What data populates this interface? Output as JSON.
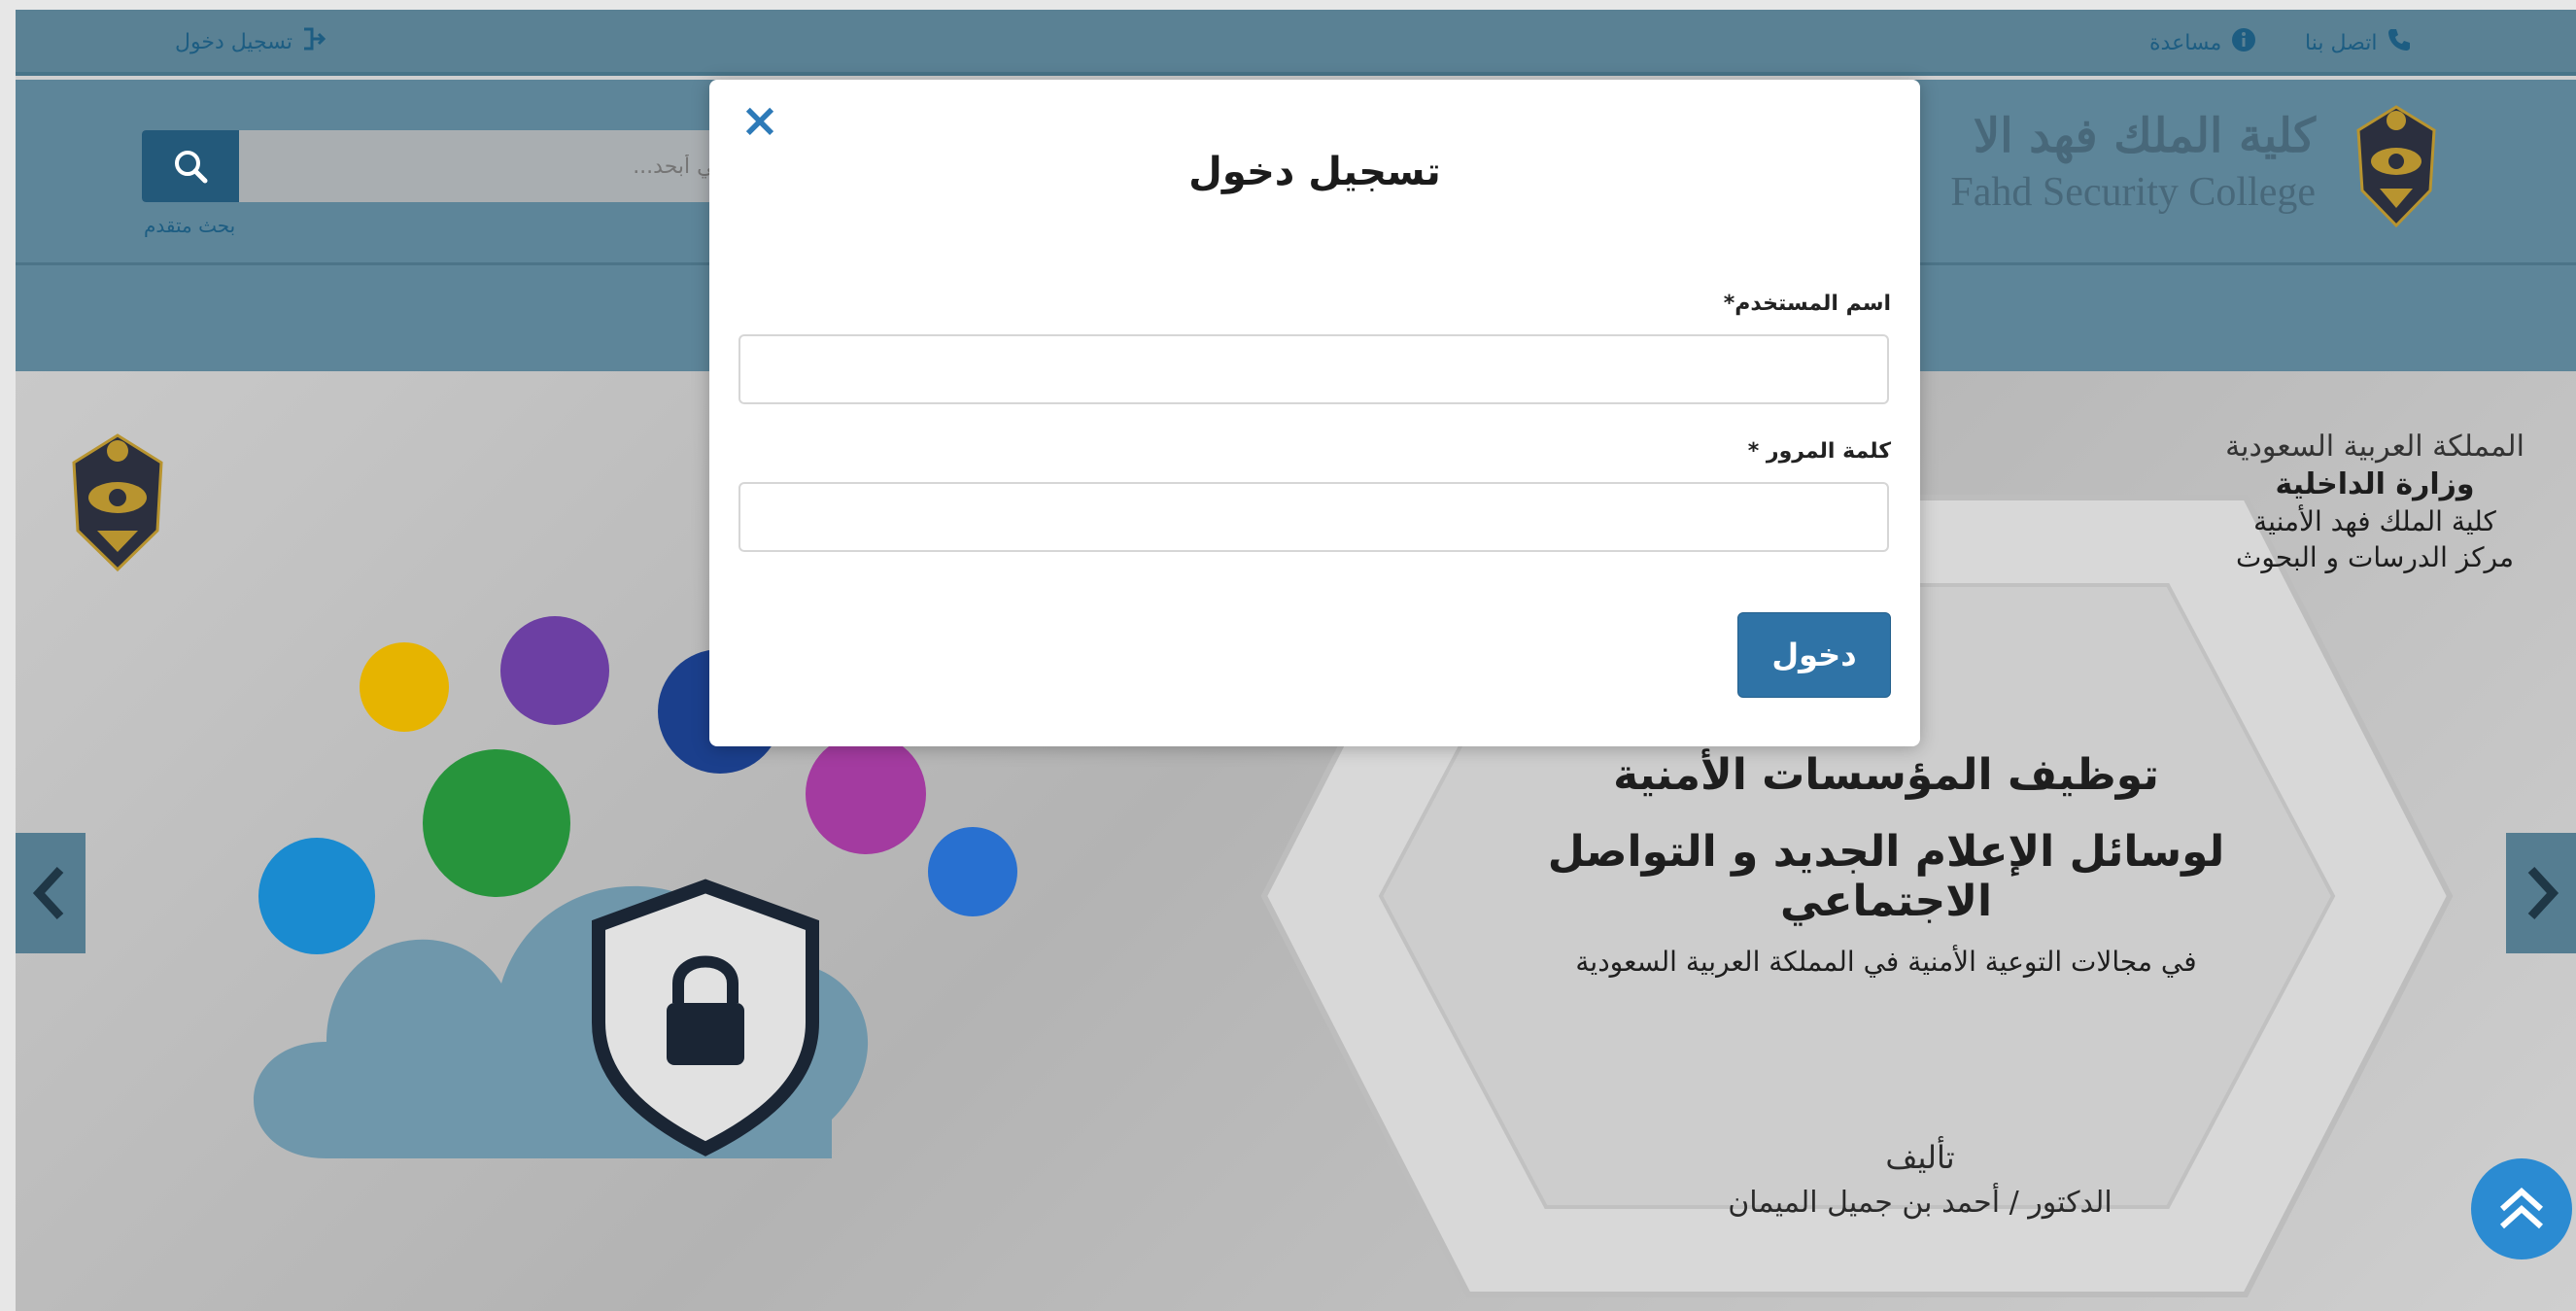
{
  "topbar": {
    "login_link": "تسجيل دخول",
    "help_link": "مساعدة",
    "contact_link": "اتصل بنا"
  },
  "header": {
    "college_name_ar": "كلية الملك فهد الا",
    "college_name_en": "Fahd Security College",
    "search_placeholder": "في أبحد...",
    "advanced_search": "بحث متقدم"
  },
  "slide": {
    "ministry_calligraphy": "المملكة العربية السعودية",
    "ministry": "وزارة الداخلية",
    "college": "كلية الملك فهد الأمنية",
    "center": "مركز الدرسات و البحوث",
    "title_line1": "توظيف المؤسسات الأمنية",
    "title_line2": "لوسائل الإعلام الجديد و التواصل الاجتماعي",
    "subtitle": "في مجالات التوعية الأمنية في المملكة العربية السعودية",
    "author_label": "تأليف",
    "author_name": "الدكتور / أحمد بن جميل الميمان"
  },
  "modal": {
    "title": "تسجيل دخول",
    "username_label": "اسم المستخدم*",
    "password_label": "كلمة المرور *",
    "username_value": "",
    "password_value": "",
    "submit_label": "دخول"
  },
  "colors": {
    "header_bg": "#5d8599",
    "accent": "#2f73a6",
    "close_icon": "#2d7ab8",
    "scroll_top": "#2b8bd2"
  },
  "icons": [
    "sign-in-icon",
    "info-icon",
    "phone-icon",
    "search-icon",
    "close-icon",
    "chevron-left-icon",
    "chevron-right-icon",
    "double-chevron-up-icon",
    "shield-lock-icon"
  ]
}
